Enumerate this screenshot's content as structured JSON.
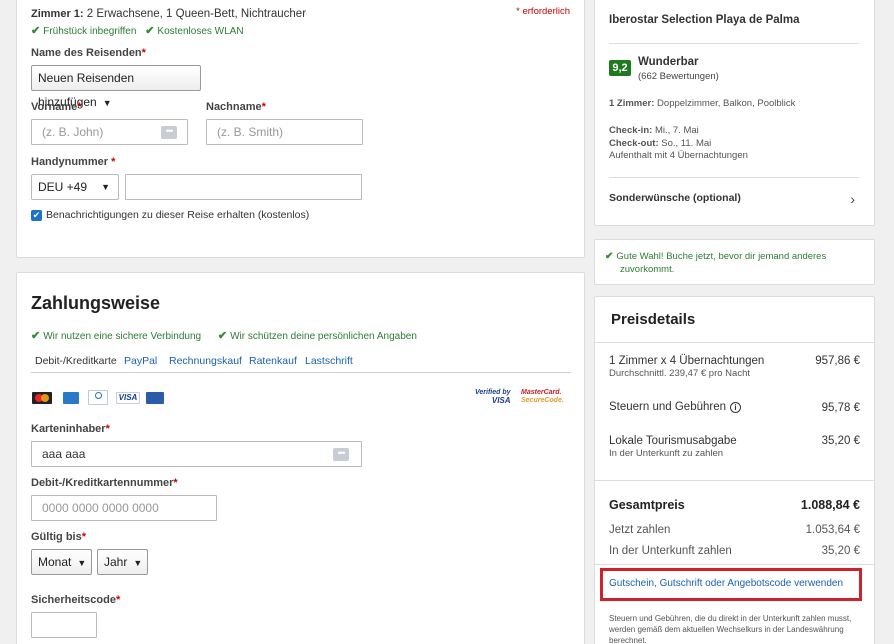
{
  "room": {
    "title": "Zimmer 1:",
    "desc": "2 Erwachsene, 1 Queen-Bett, Nichtraucher",
    "required_note": "* erforderlich",
    "amenity1": "Frühstück inbegriffen",
    "amenity2": "Kostenloses WLAN"
  },
  "traveler": {
    "name_label": "Name des Reisenden",
    "name_select": "Neuen Reisenden hinzufügen",
    "first_label": "Vorname",
    "first_placeholder": "(z. B. John)",
    "last_label": "Nachname",
    "last_placeholder": "(z. B. Smith)",
    "phone_label": "Handynummer",
    "phone_code": "DEU +49",
    "phone_value": "",
    "notify_label": "Benachrichtigungen zu dieser Reise erhalten (kostenlos)",
    "required_mark": "*"
  },
  "payment": {
    "title": "Zahlungsweise",
    "secure1": "Wir nutzen eine sichere Verbindung",
    "secure2": "Wir schützen deine persönlichen Angaben",
    "tabs": [
      "Debit-/Kreditkarte",
      "PayPal",
      "Rechnungskauf",
      "Ratenkauf",
      "Lastschrift"
    ],
    "verified_line1": "Verified by",
    "verified_line2": "VISA",
    "mc_line1": "MasterCard.",
    "mc_line2": "SecureCode.",
    "visa_logo": "VISA",
    "holder_label": "Karteninhaber",
    "holder_value": "aaa aaa",
    "number_label": "Debit-/Kreditkartennummer",
    "number_placeholder": "0000 0000 0000 0000",
    "expiry_label": "Gültig bis",
    "month": "Monat",
    "year": "Jahr",
    "cvv_label": "Sicherheitscode"
  },
  "hotel": {
    "name": "Iberostar Selection Playa de Palma",
    "score": "9,2",
    "rating_word": "Wunderbar",
    "reviews": "(662 Bewertungen)",
    "room_label": "1 Zimmer:",
    "room_value": "Doppelzimmer, Balkon, Poolblick",
    "checkin_label": "Check-in:",
    "checkin_value": "Mi., 7. Mai",
    "checkout_label": "Check-out:",
    "checkout_value": "So., 11. Mai",
    "stay": "Aufenthalt mit 4 Übernachtungen",
    "special": "Sonderwünsche (optional)"
  },
  "notice": {
    "line1": "Gute Wahl! Buche jetzt, bevor dir jemand anderes",
    "line2": "zuvorkommt."
  },
  "prices": {
    "title": "Preisdetails",
    "rooms_label": "1 Zimmer x 4 Übernachtungen",
    "rooms_sub": "Durchschnittl. 239,47 € pro Nacht",
    "rooms_value": "957,86 €",
    "tax_label": "Steuern und Gebühren",
    "tax_value": "95,78 €",
    "tourism_label": "Lokale Tourismusabgabe",
    "tourism_sub": "In der Unterkunft zu zahlen",
    "tourism_value": "35,20 €",
    "total_label": "Gesamtpreis",
    "total_value": "1.088,84 €",
    "now_label": "Jetzt zahlen",
    "now_value": "1.053,64 €",
    "later_label": "In der Unterkunft zahlen",
    "later_value": "35,20 €",
    "coupon": "Gutschein, Gutschrift oder Angebotscode verwenden",
    "footnote1": "Steuern und Gebühren, die du direkt in der Unterkunft zahlen musst,",
    "footnote2": "werden gemäß dem aktuellen Wechselkurs in der Landeswährung",
    "footnote3": "berechnet."
  },
  "colors": {
    "accent": "#1a61b0",
    "success": "#2e7d32",
    "score_bg": "#1f7a1f",
    "highlight": "#d0202a"
  }
}
